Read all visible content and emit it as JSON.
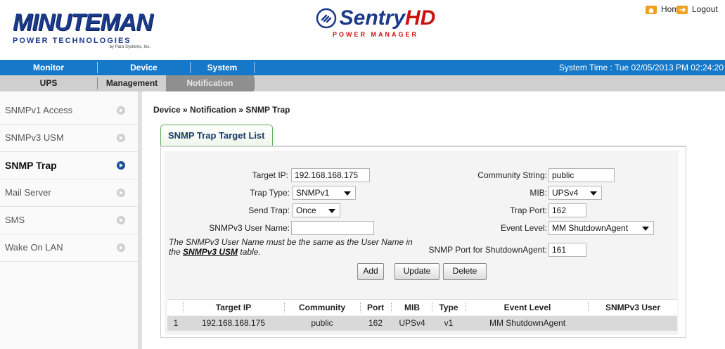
{
  "header": {
    "brand_name": "MINUTEMAN",
    "brand_subtitle": "POWER TECHNOLOGIES",
    "brand_tiny": "by Para Systems, Inc.",
    "product_name": "Sentry",
    "product_suffix": "HD",
    "product_sub": "POWER MANAGER",
    "home_label": "Home",
    "logout_label": "Logout"
  },
  "nav_main": {
    "items": [
      "Monitor",
      "Device",
      "System"
    ],
    "active": "Device",
    "system_time": "System Time : Tue 02/05/2013 PM 02:24:20"
  },
  "nav_sub": {
    "items": [
      "UPS",
      "Management",
      "Notification"
    ],
    "active": "Notification"
  },
  "sidebar": {
    "items": [
      "SNMPv1 Access",
      "SNMPv3 USM",
      "SNMP Trap",
      "Mail Server",
      "SMS",
      "Wake On LAN"
    ],
    "active": "SNMP Trap"
  },
  "breadcrumb": "Device » Notification » SNMP Trap",
  "tab_title": "SNMP Trap Target List",
  "form": {
    "target_ip_label": "Target IP:",
    "target_ip_value": "192.168.168.175",
    "trap_type_label": "Trap Type:",
    "trap_type_value": "SNMPv1",
    "send_trap_label": "Send Trap:",
    "send_trap_value": "Once",
    "snmpv3_user_label": "SNMPv3 User Name:",
    "snmpv3_user_value": "",
    "community_label": "Community String:",
    "community_value": "public",
    "mib_label": "MIB:",
    "mib_value": "UPSv4",
    "trap_port_label": "Trap Port:",
    "trap_port_value": "162",
    "event_level_label": "Event Level:",
    "event_level_value": "MM ShutdownAgent",
    "shutdown_port_label": "SNMP Port for ShutdownAgent:",
    "shutdown_port_value": "161",
    "note_part1": "The SNMPv3 User Name must be the same as the User Name in the",
    "note_link": "SNMPv3 USM",
    "note_part2": "table."
  },
  "buttons": {
    "add": "Add",
    "update": "Update",
    "delete": "Delete"
  },
  "table": {
    "headers": [
      "",
      "Target IP",
      "Community",
      "Port",
      "MIB",
      "Type",
      "Event Level",
      "SNMPv3 User"
    ],
    "rows": [
      [
        "1",
        "192.168.168.175",
        "public",
        "162",
        "UPSv4",
        "v1",
        "MM ShutdownAgent",
        ""
      ]
    ]
  },
  "colors": {
    "nav_main_bg": "#1678c8",
    "nav_sub_bg": "#cfcfcf",
    "tab_border": "#5fb05a",
    "brand_blue": "#1a3a8a",
    "accent_red": "#cc1111"
  }
}
